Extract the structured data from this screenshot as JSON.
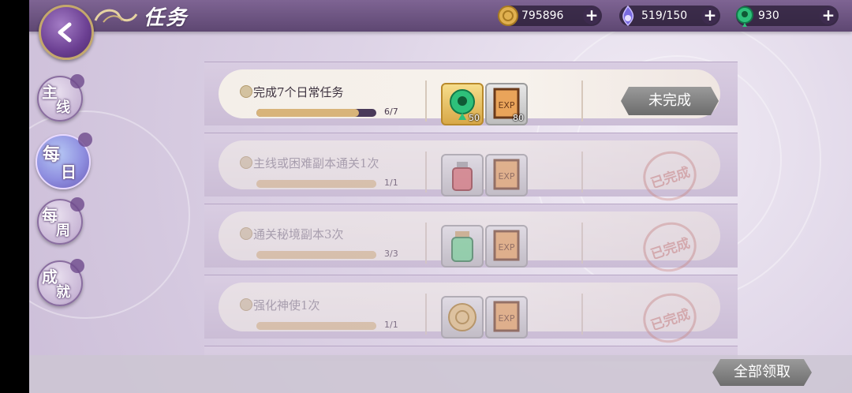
{
  "header": {
    "title": "任务",
    "resources": [
      {
        "name": "coin",
        "value": "795896",
        "icon": "coin-icon",
        "color": "#e0b050"
      },
      {
        "name": "stamina",
        "value": "519/150",
        "icon": "spirit-flame-icon",
        "color": "#7a6be0"
      },
      {
        "name": "jade",
        "value": "930",
        "icon": "green-jade-icon",
        "color": "#2ec07a"
      }
    ]
  },
  "tabs": [
    {
      "line1": "主",
      "line2": "线",
      "active": false
    },
    {
      "line1": "每",
      "line2": "日",
      "active": true
    },
    {
      "line1": "每",
      "line2": "周",
      "active": false
    },
    {
      "line1": "成",
      "line2": "就",
      "active": false
    }
  ],
  "tasks": [
    {
      "title": "完成7个日常任务",
      "progress": "6/7",
      "ratio": 0.857,
      "done": false,
      "status": "未完成",
      "rewards": [
        {
          "icon": "green-jade-icon",
          "count": "50"
        },
        {
          "icon": "exp-lantern-icon",
          "count": "80"
        }
      ]
    },
    {
      "title": "主线或困难副本通关1次",
      "progress": "1/1",
      "ratio": 1,
      "done": true,
      "status": "已完成",
      "rewards": [
        {
          "icon": "potion-bottle-icon",
          "count": ""
        },
        {
          "icon": "exp-lantern-icon",
          "count": ""
        }
      ]
    },
    {
      "title": "通关秘境副本3次",
      "progress": "3/3",
      "ratio": 1,
      "done": true,
      "status": "已完成",
      "rewards": [
        {
          "icon": "green-jar-icon",
          "count": ""
        },
        {
          "icon": "exp-lantern-icon",
          "count": ""
        }
      ]
    },
    {
      "title": "强化神使1次",
      "progress": "1/1",
      "ratio": 1,
      "done": true,
      "status": "已完成",
      "rewards": [
        {
          "icon": "coin-icon",
          "count": ""
        },
        {
          "icon": "exp-lantern-icon",
          "count": ""
        }
      ]
    }
  ],
  "footer": {
    "claim_all": "全部领取"
  },
  "icons": {
    "exp_label": "EXP"
  }
}
